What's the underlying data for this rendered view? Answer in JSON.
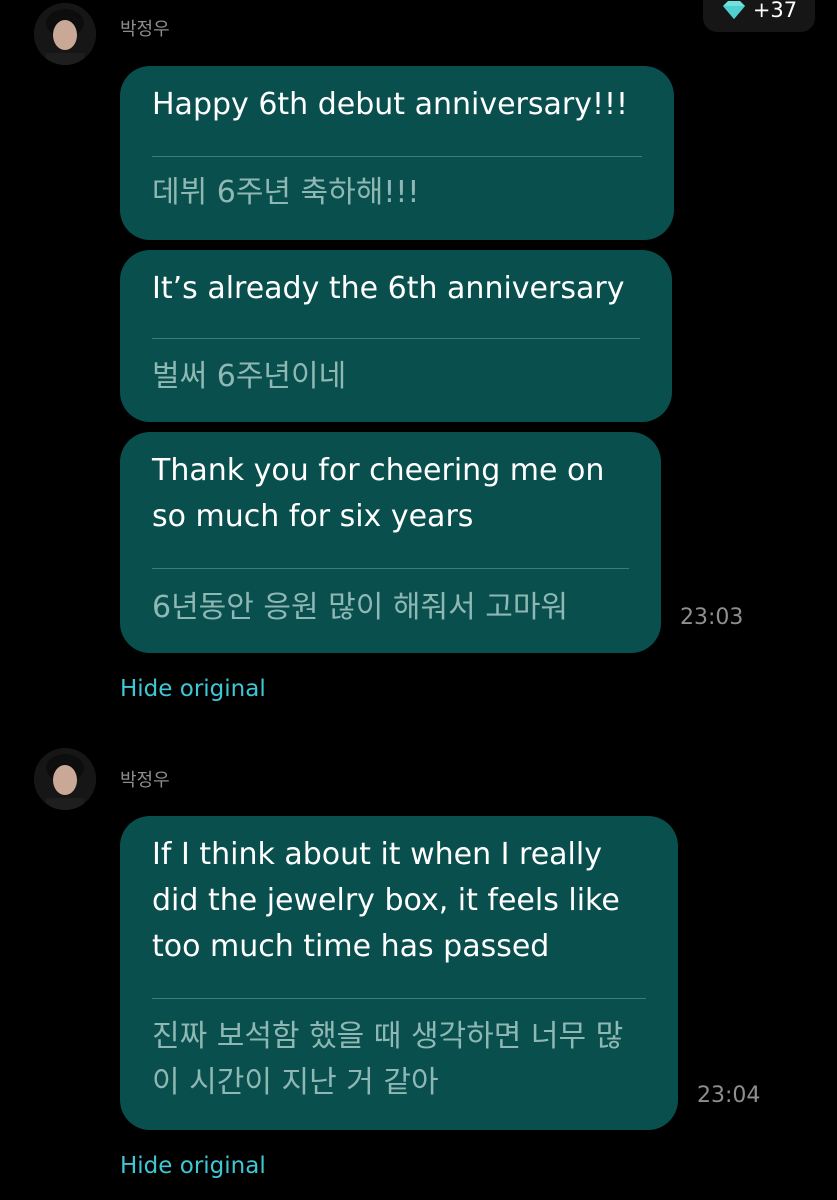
{
  "header": {
    "badge_count": "+37",
    "badge_icon": "diamond-icon",
    "accent_color": "#6fe2e0"
  },
  "colors": {
    "background": "#000000",
    "bubble": "#084f4d",
    "link": "#3fc7d3",
    "translation_text": "#8fb7b4"
  },
  "groups": [
    {
      "sender": "박정우",
      "avatar_icon": "artist-avatar",
      "messages": [
        {
          "en": "Happy 6th debut anniversary!!!",
          "ko": "데뷔 6주년 축하해!!!",
          "time": ""
        },
        {
          "en": "It’s already the 6th anniversary",
          "ko": "벌써 6주년이네",
          "time": ""
        },
        {
          "en": "Thank you for cheering me on\nso much for six years",
          "ko": "6년동안 응원 많이 해줘서 고마워",
          "time": "23:03"
        }
      ],
      "toggle_label": "Hide original"
    },
    {
      "sender": "박정우",
      "avatar_icon": "artist-avatar",
      "messages": [
        {
          "en": "If I think about it when I really\ndid the jewelry box, it feels like\ntoo much time has passed",
          "ko": "진짜 보석함 했을 때 생각하면 너무 많\n이 시간이 지난 거 같아",
          "time": "23:04"
        }
      ],
      "toggle_label": "Hide original"
    }
  ]
}
